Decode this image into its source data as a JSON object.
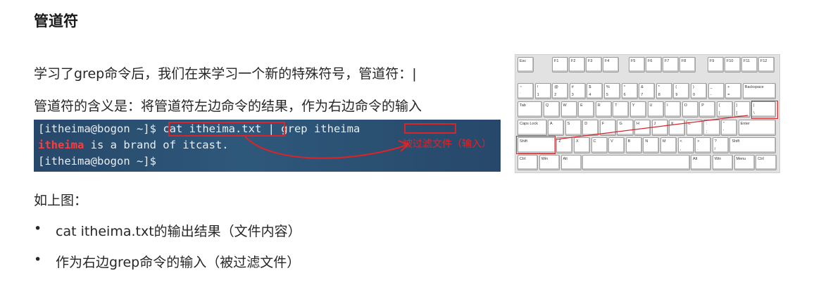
{
  "title": "管道符",
  "intro": "学习了grep命令后，我们在来学习一个新的特殊符号，管道符：|",
  "meaning": "管道符的含义是：将管道符左边命令的结果，作为右边命令的输入",
  "terminal": {
    "prompt1": "[itheima@bogon ~]$",
    "command": "cat itheima.txt",
    "pipe_rest": " | grep itheima",
    "match": "itheima",
    "output_rest": " is a brand of itcast.",
    "prompt2": "[itheima@bogon ~]$",
    "annotation": "被过滤文件（输入）"
  },
  "as_shown": "如上图：",
  "bullets": [
    "cat itheima.txt的输出结果（文件内容）",
    "作为右边grep命令的输入（被过滤文件）"
  ],
  "keyboard": {
    "rows": [
      [
        {
          "t": "Esc"
        },
        {
          "t": "F1"
        },
        {
          "t": "F2"
        },
        {
          "t": "F3"
        },
        {
          "t": "F4"
        },
        {
          "t": "F5"
        },
        {
          "t": "F6"
        },
        {
          "t": "F7"
        },
        {
          "t": "F8"
        },
        {
          "t": "F9"
        },
        {
          "t": "F10"
        },
        {
          "t": "F11"
        },
        {
          "t": "F12"
        }
      ],
      [
        {
          "t": "~",
          "b": "`"
        },
        {
          "t": "!",
          "b": "1"
        },
        {
          "t": "@",
          "b": "2"
        },
        {
          "t": "#",
          "b": "3"
        },
        {
          "t": "$",
          "b": "4"
        },
        {
          "t": "%",
          "b": "5"
        },
        {
          "t": "^",
          "b": "6"
        },
        {
          "t": "&",
          "b": "7"
        },
        {
          "t": "*",
          "b": "8"
        },
        {
          "t": "(",
          "b": "9"
        },
        {
          "t": ")",
          "b": "0"
        },
        {
          "t": "_",
          "b": "-"
        },
        {
          "t": "+",
          "b": "="
        },
        {
          "t": "Backspace"
        }
      ],
      [
        {
          "t": "Tab"
        },
        {
          "t": "Q"
        },
        {
          "t": "W"
        },
        {
          "t": "E"
        },
        {
          "t": "R"
        },
        {
          "t": "T"
        },
        {
          "t": "Y"
        },
        {
          "t": "U"
        },
        {
          "t": "I"
        },
        {
          "t": "O"
        },
        {
          "t": "P"
        },
        {
          "t": "{",
          "b": "["
        },
        {
          "t": "}",
          "b": "]"
        },
        {
          "t": "|",
          "b": "\\"
        }
      ],
      [
        {
          "t": "Caps Lock"
        },
        {
          "t": "A"
        },
        {
          "t": "S"
        },
        {
          "t": "D"
        },
        {
          "t": "F"
        },
        {
          "t": "G"
        },
        {
          "t": "H"
        },
        {
          "t": "J"
        },
        {
          "t": "K"
        },
        {
          "t": "L"
        },
        {
          "t": ":",
          "b": ";"
        },
        {
          "t": "\"",
          "b": "'"
        },
        {
          "t": "Enter"
        }
      ],
      [
        {
          "t": "Shift"
        },
        {
          "t": "Z"
        },
        {
          "t": "X"
        },
        {
          "t": "C"
        },
        {
          "t": "V"
        },
        {
          "t": "B"
        },
        {
          "t": "N"
        },
        {
          "t": "M"
        },
        {
          "t": "<",
          "b": ","
        },
        {
          "t": ">",
          "b": "."
        },
        {
          "t": "?",
          "b": "/"
        },
        {
          "t": "Shift"
        }
      ],
      [
        {
          "t": "Ctrl"
        },
        {
          "t": "Win"
        },
        {
          "t": "Alt"
        },
        {
          "t": ""
        },
        {
          "t": "Alt"
        },
        {
          "t": "Win"
        },
        {
          "t": "Menu"
        },
        {
          "t": "Ctrl"
        }
      ]
    ]
  }
}
